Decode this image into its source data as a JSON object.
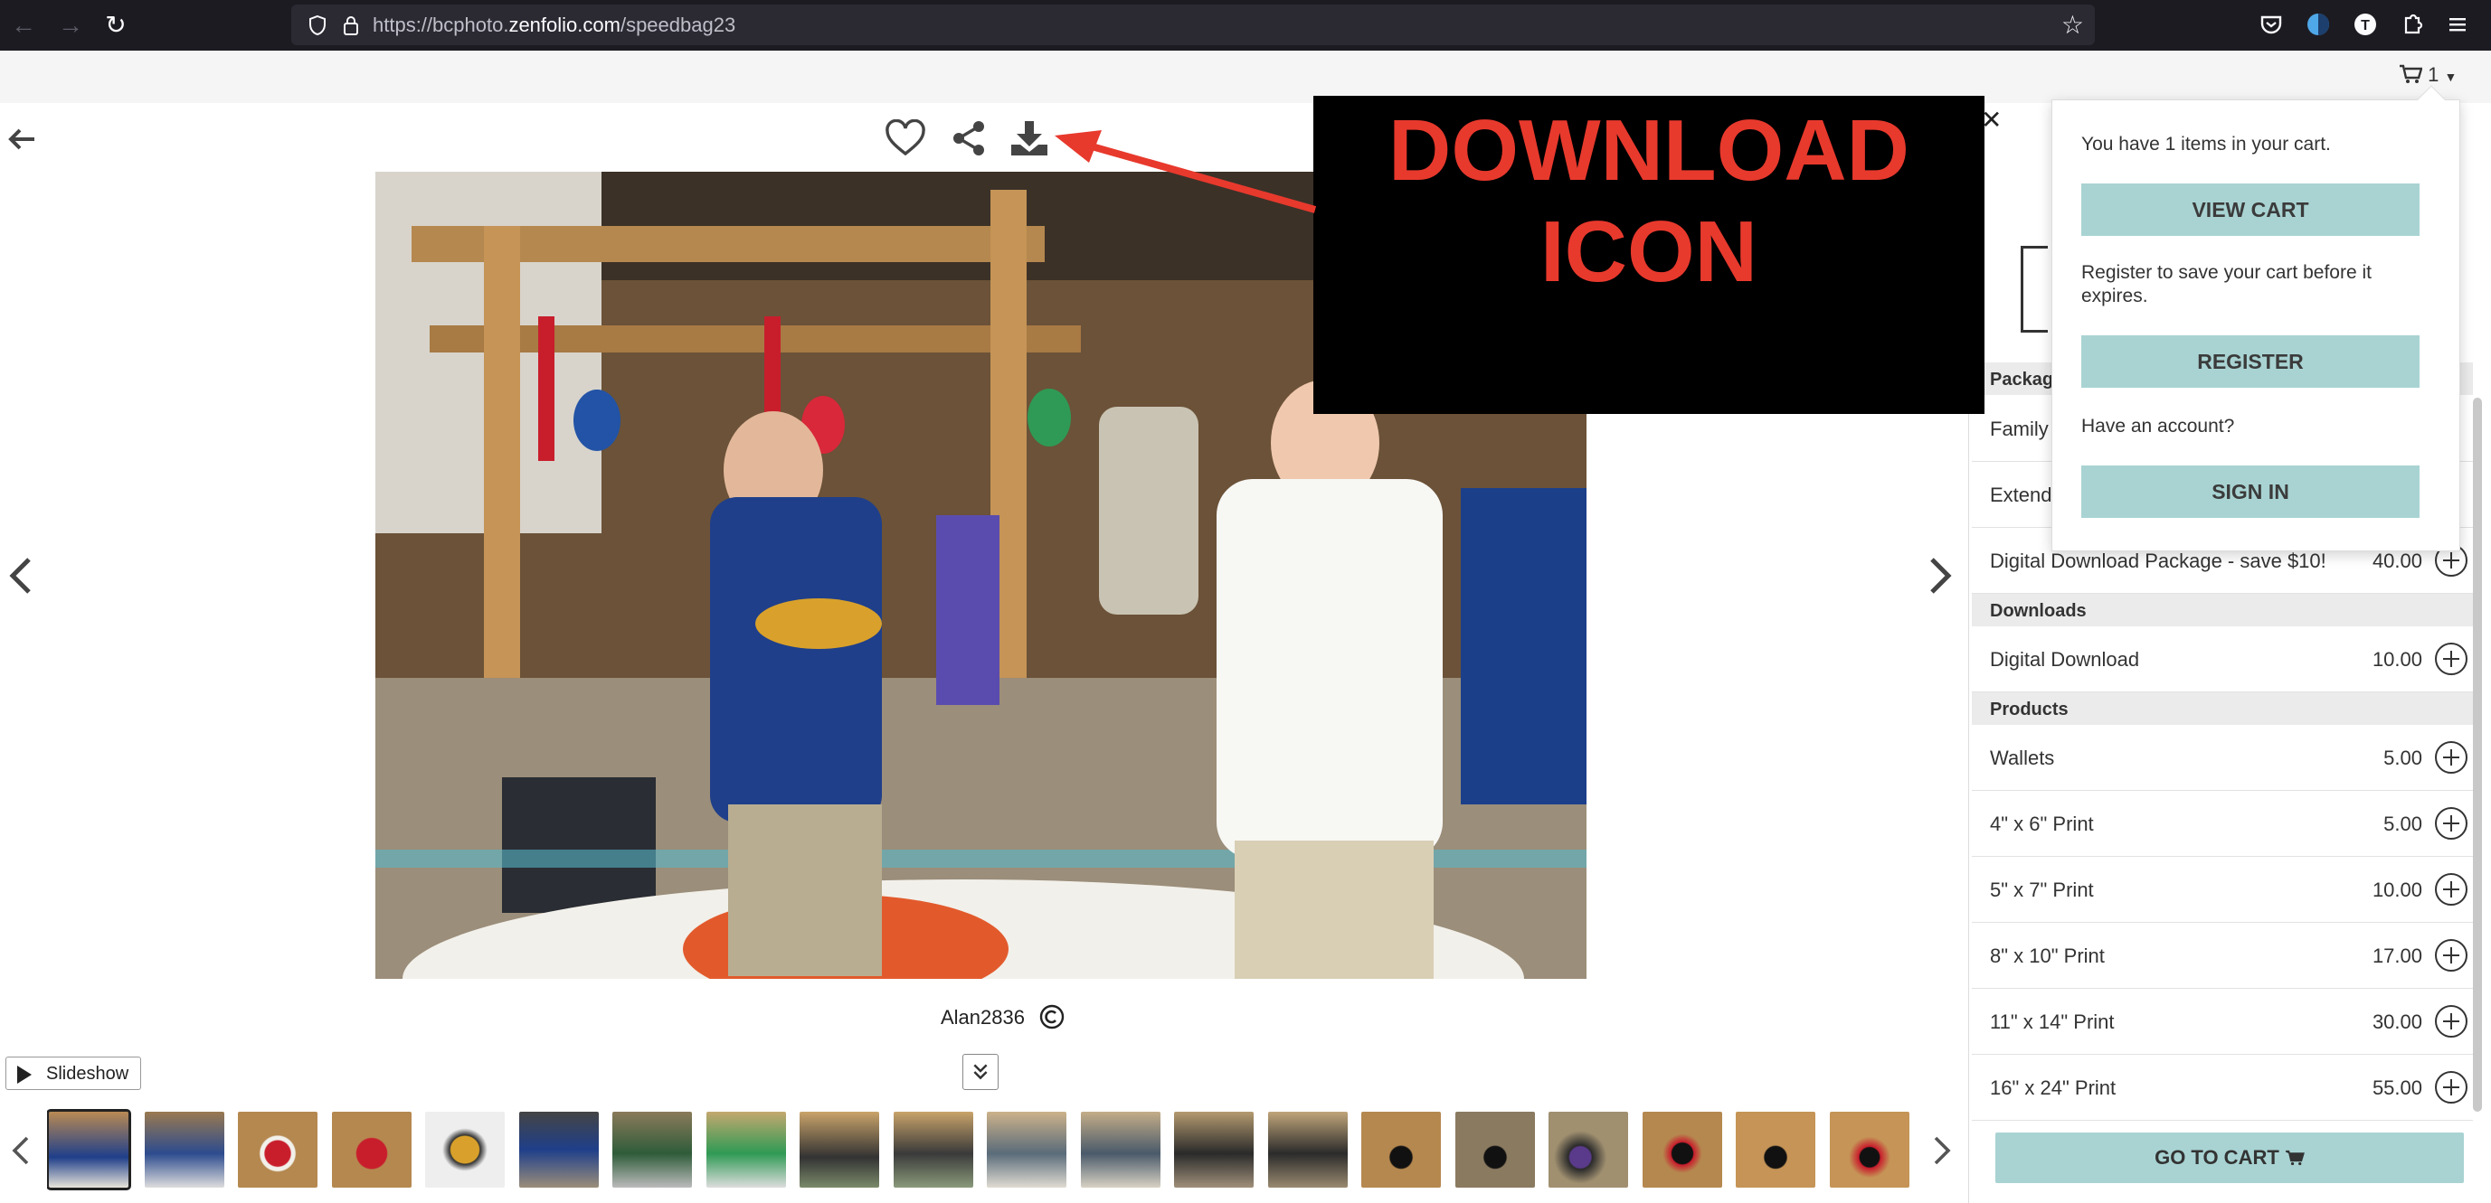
{
  "browser": {
    "url_prefix": "https://bcphoto.",
    "url_domain": "zenfolio.com",
    "url_path": "/speedbag23"
  },
  "site": {
    "cart_count": "1"
  },
  "viewer": {
    "caption": "Alan2836",
    "slideshow_label": "Slideshow"
  },
  "annotation": {
    "line1": "DOWNLOAD",
    "line2": "ICON",
    "color": "#e8392d"
  },
  "cart_popup": {
    "message": "You have 1 items in your cart.",
    "view_cart": "VIEW CART",
    "register_text": "Register to save your cart before it expires.",
    "register": "REGISTER",
    "account_text": "Have an account?",
    "sign_in": "SIGN IN"
  },
  "panel": {
    "packages_head": "Package",
    "packages": [
      {
        "name": "Family p",
        "price": ""
      },
      {
        "name": "Extende",
        "price": ""
      },
      {
        "name": "Digital Download Package - save $10!",
        "price": "40.00"
      }
    ],
    "downloads_head": "Downloads",
    "downloads": [
      {
        "name": "Digital Download",
        "price": "10.00"
      }
    ],
    "products_head": "Products",
    "products": [
      {
        "name": "Wallets",
        "price": "5.00"
      },
      {
        "name": "4\" x 6\" Print",
        "price": "5.00"
      },
      {
        "name": "5\" x 7\" Print",
        "price": "10.00"
      },
      {
        "name": "8\" x 10\" Print",
        "price": "17.00"
      },
      {
        "name": "11\" x 14\" Print",
        "price": "30.00"
      },
      {
        "name": "16\" x 24\" Print",
        "price": "55.00"
      }
    ],
    "go_to_cart": "GO TO CART",
    "accent": "#a9d3d3"
  }
}
